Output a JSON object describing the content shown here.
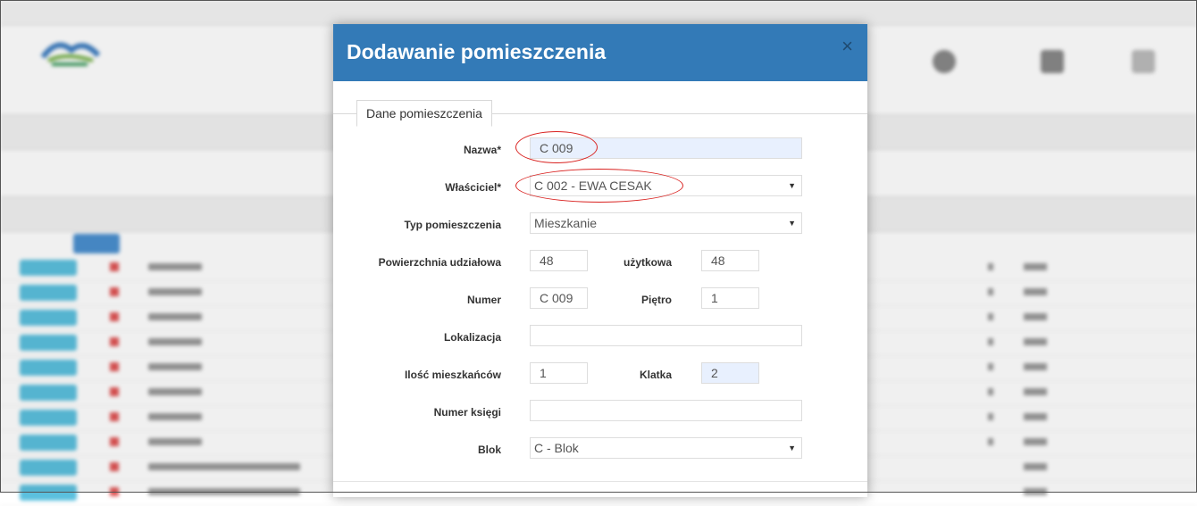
{
  "modal": {
    "title": "Dodawanie pomieszczenia",
    "close_glyph": "×",
    "tab_label": "Dane pomieszczenia",
    "fields": {
      "nazwa": {
        "label": "Nazwa*",
        "value": "C 009"
      },
      "wlasciciel": {
        "label": "Właściciel*",
        "value": "C 002 - EWA CESAK"
      },
      "typ": {
        "label": "Typ pomieszczenia",
        "value": "Mieszkanie"
      },
      "pow_udzialowa": {
        "label": "Powierzchnia udziałowa",
        "value": "48"
      },
      "pow_uzytkowa": {
        "label": "użytkowa",
        "value": "48"
      },
      "numer": {
        "label": "Numer",
        "value": "C 009"
      },
      "pietro": {
        "label": "Piętro",
        "value": "1"
      },
      "lokalizacja": {
        "label": "Lokalizacja",
        "value": ""
      },
      "mieszkancy": {
        "label": "Ilość mieszkańców",
        "value": "1"
      },
      "klatka": {
        "label": "Klatka",
        "value": "2"
      },
      "numer_ksiegi": {
        "label": "Numer księgi",
        "value": ""
      },
      "blok": {
        "label": "Blok",
        "value": "C - Blok"
      }
    },
    "caret": "▼",
    "header_color": "#337ab7",
    "highlight_color": "#d9211f"
  }
}
